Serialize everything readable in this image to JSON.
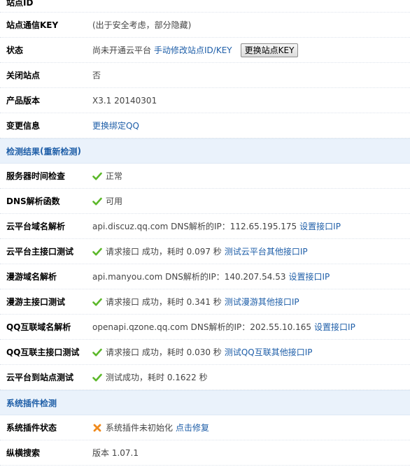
{
  "rows_top": [
    {
      "label": "站点ID"
    },
    {
      "label": "站点通信KEY",
      "value": "(出于安全考虑，部分隐藏)"
    },
    {
      "label": "状态",
      "value": "尚未开通云平台",
      "link": "手动修改站点ID/KEY",
      "button": "更换站点KEY"
    },
    {
      "label": "关闭站点",
      "value": "否"
    },
    {
      "label": "产品版本",
      "value": "X3.1 20140301"
    },
    {
      "label": "变更信息",
      "link": "更换绑定QQ"
    }
  ],
  "section_detect": {
    "title": "检测结果",
    "open": "(",
    "link": "重新检测",
    "close": ")"
  },
  "rows_detect": [
    {
      "label": "服务器时间检查",
      "status": "ok",
      "value": "正常"
    },
    {
      "label": "DNS解析函数",
      "status": "ok",
      "value": "可用"
    },
    {
      "label": "云平台域名解析",
      "value": "api.discuz.qq.com DNS解析的IP：112.65.195.175",
      "link": "设置接口IP"
    },
    {
      "label": "云平台主接口测试",
      "status": "ok",
      "value": "请求接口 成功，耗时 0.097 秒",
      "link": "测试云平台其他接口IP"
    },
    {
      "label": "漫游域名解析",
      "value": "api.manyou.com DNS解析的IP：140.207.54.53",
      "link": "设置接口IP"
    },
    {
      "label": "漫游主接口测试",
      "status": "ok",
      "value": "请求接口 成功，耗时 0.341 秒",
      "link": "测试漫游其他接口IP"
    },
    {
      "label": "QQ互联域名解析",
      "value": "openapi.qzone.qq.com DNS解析的IP：202.55.10.165",
      "link": "设置接口IP"
    },
    {
      "label": "QQ互联主接口测试",
      "status": "ok",
      "value": "请求接口 成功，耗时 0.030 秒",
      "link": "测试QQ互联其他接口IP"
    },
    {
      "label": "云平台到站点测试",
      "status": "ok",
      "value": "测试成功，耗时 0.1622 秒"
    }
  ],
  "section_plugin": {
    "title": "系统插件检测"
  },
  "rows_plugin": [
    {
      "label": "系统插件状态",
      "status": "error",
      "value": "系统插件未初始化",
      "link": "点击修复"
    },
    {
      "label": "纵横搜索",
      "value": "版本 1.07.1"
    }
  ],
  "icons": {
    "ok": "check-icon",
    "error": "cross-icon"
  },
  "colors": {
    "link": "#1e5ea8",
    "section_bg": "#eaf2fb",
    "section_text": "#1f5fa8",
    "ok": "#5cb82a",
    "error": "#f08a1c"
  }
}
